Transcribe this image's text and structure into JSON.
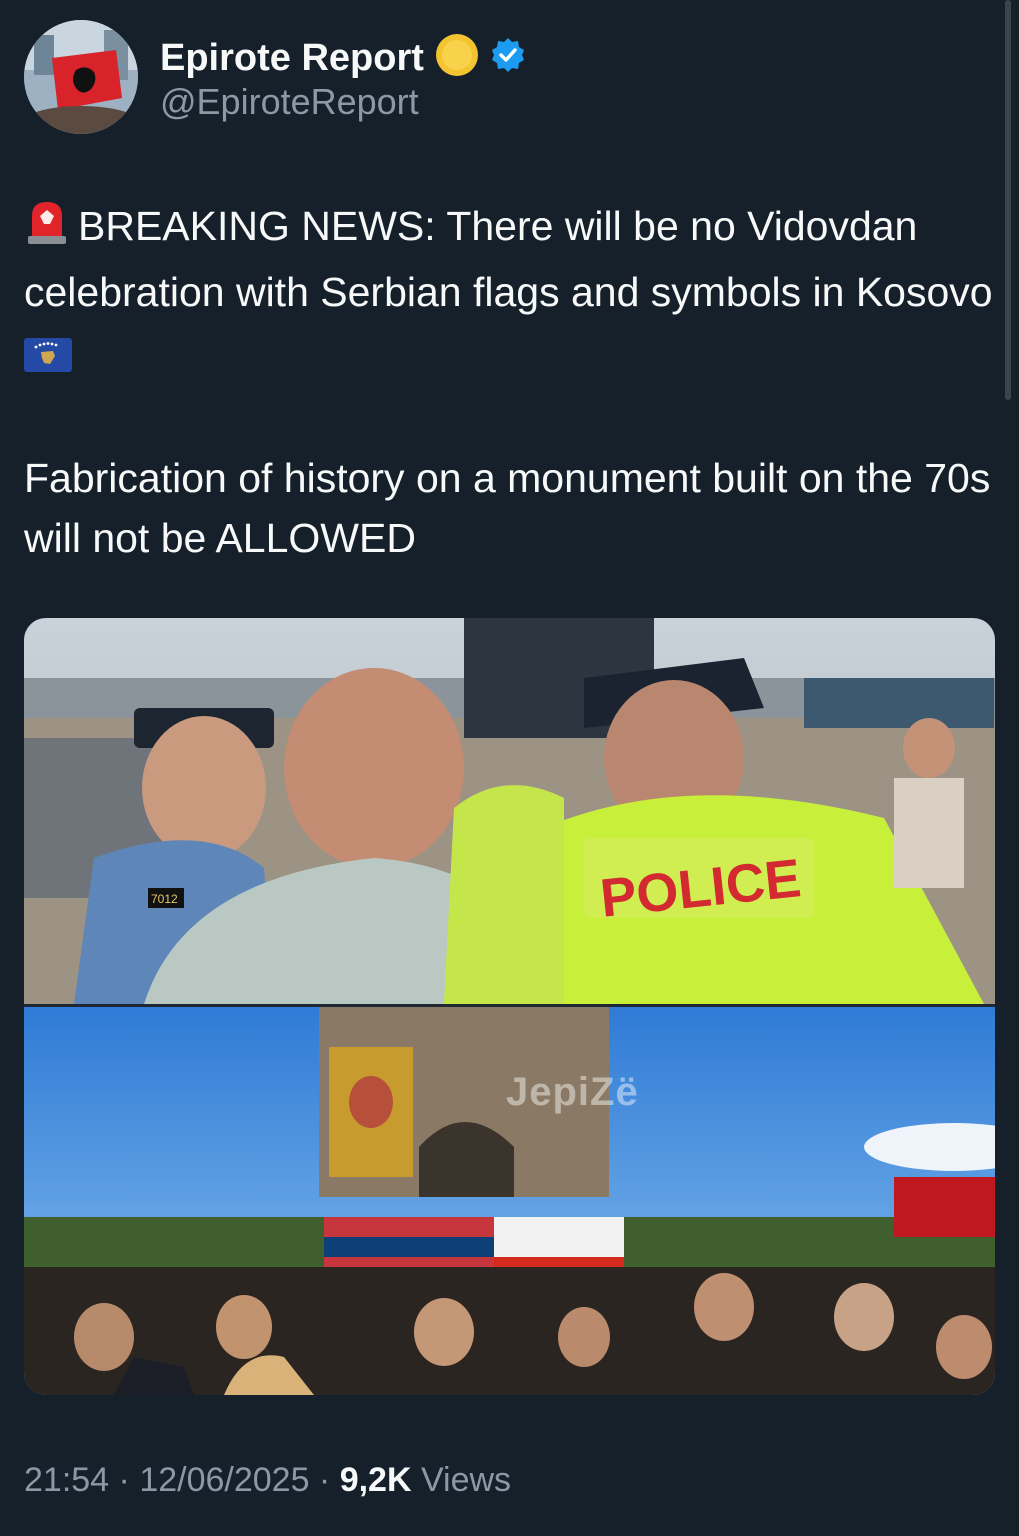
{
  "author": {
    "display_name": "Epirote Report",
    "handle": "@EpiroteReport",
    "verified_color": "#1d9bf0",
    "badge_emoji_color": "#f4c430"
  },
  "tweet": {
    "line1": "BREAKING NEWS: There will be no Vidovdan celebration with Serbian flags and symbols in Kosovo",
    "line2": "Fabrication of history on a monument built on the 70s will not be ALLOWED",
    "alert_icon": "police-light-icon",
    "flag_icon": "kosovo-flag-icon"
  },
  "media": {
    "top_photo_vest_text": "POLICE",
    "badge_number": "7012",
    "watermark": "JepiZë"
  },
  "meta": {
    "time": "21:54",
    "sep1": " · ",
    "date": "12/06/2025",
    "sep2": " · ",
    "views_count": "9,2K",
    "views_label": " Views"
  }
}
